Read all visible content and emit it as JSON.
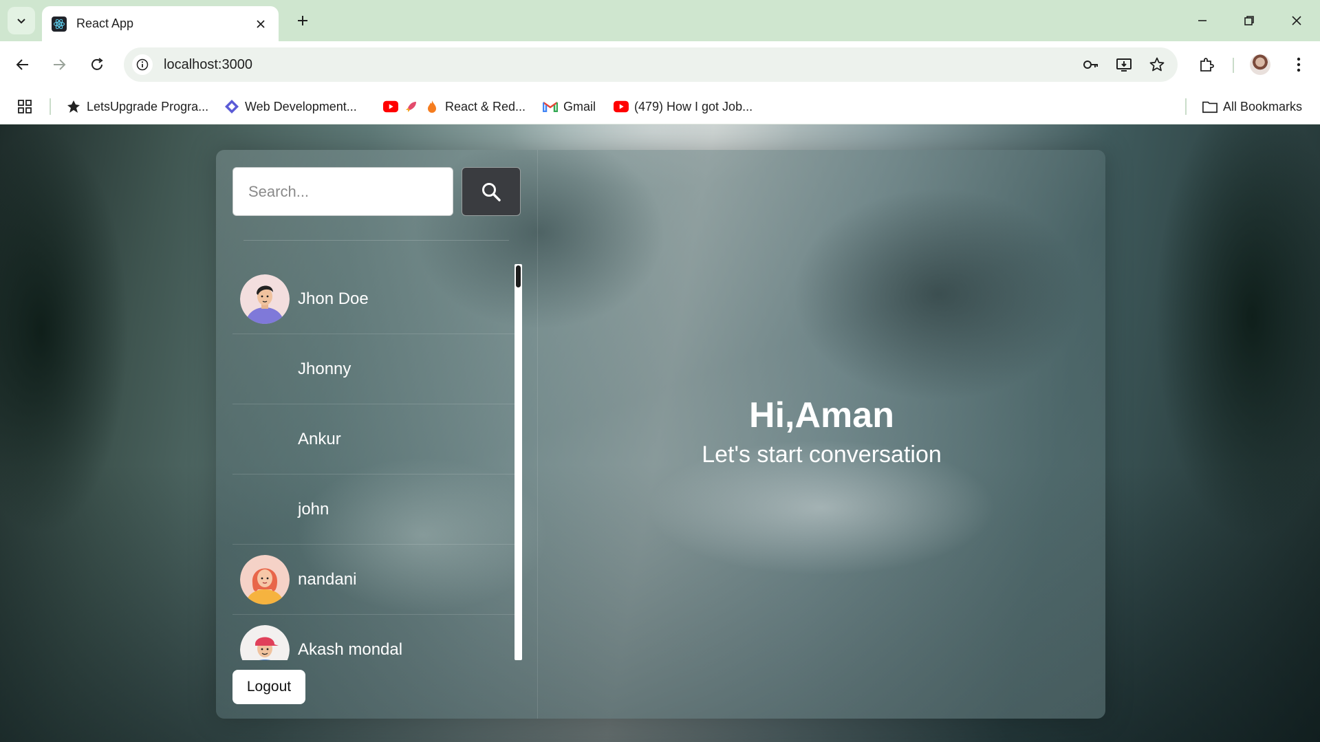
{
  "browser": {
    "tab_title": "React App",
    "url": "localhost:3000",
    "bookmarks": [
      {
        "label": "LetsUpgrade Progra...",
        "icon": "letsupgrade-icon"
      },
      {
        "label": "Web Development...",
        "icon": "diamond-icon"
      },
      {
        "label": "React & Red...",
        "icon": "youtube-icon"
      },
      {
        "label": "Gmail",
        "icon": "gmail-icon"
      },
      {
        "label": "(479) How I got Job...",
        "icon": "youtube-icon"
      }
    ],
    "all_bookmarks_label": "All Bookmarks"
  },
  "sidebar": {
    "search_placeholder": "Search...",
    "contacts": [
      {
        "name": "Jhon Doe",
        "avatar": "male-avatar"
      },
      {
        "name": "Jhonny",
        "avatar": ""
      },
      {
        "name": "Ankur",
        "avatar": ""
      },
      {
        "name": "john",
        "avatar": ""
      },
      {
        "name": "nandani",
        "avatar": "female-avatar"
      },
      {
        "name": "Akash mondal",
        "avatar": "cap-avatar"
      }
    ],
    "logout_label": "Logout"
  },
  "welcome": {
    "title": "Hi,Aman",
    "subtitle": "Let's start conversation"
  }
}
